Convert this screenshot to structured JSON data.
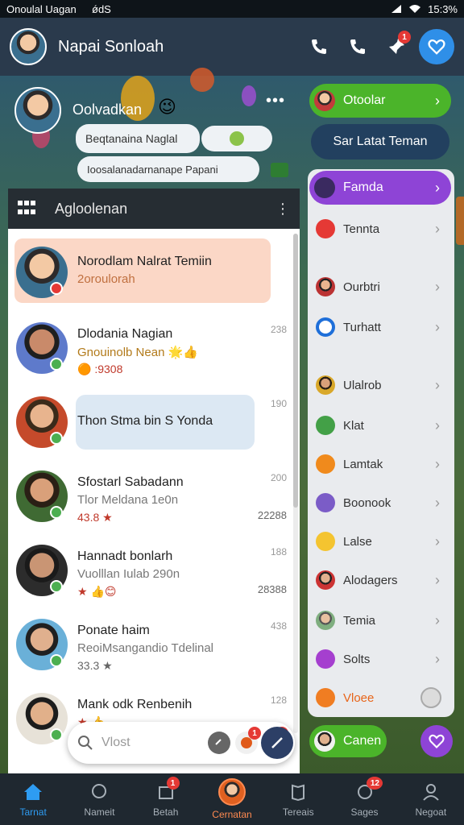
{
  "status_bar": {
    "left_text": "Onoulal Uagan",
    "carrier": "ǿdS",
    "time": "15:3%"
  },
  "header": {
    "title": "Napai Sonloah",
    "badge_count": "1"
  },
  "profile": {
    "name": "Oolvadkan",
    "emoji": "😉",
    "more": "•••",
    "bubble1": "Beqtanaina Naglal",
    "bubble2": "Ioosalanadarnanape Papani"
  },
  "left_panel": {
    "title": "Agloolenan"
  },
  "chats": [
    {
      "name": "Norodlam Nalrat Temiin",
      "sub": "2oroulorah",
      "extra": "",
      "time": "",
      "count": ""
    },
    {
      "name": "Dlodania Nagian",
      "sub": "Gnouinolb Nean 🌟👍",
      "extra": "🟠 :9308",
      "time": "238",
      "count": ""
    },
    {
      "name": "Thon Stma bin S Yonda",
      "sub": "",
      "extra": "",
      "time": "190",
      "count": ""
    },
    {
      "name": "Sfostarl Sabadann",
      "sub": "Tlor Meldana 1e0n",
      "extra": "43.8 ★",
      "time": "200",
      "count": "22288"
    },
    {
      "name": "Hannadt bonlarh",
      "sub": "Vuolllan Iulab 290n",
      "extra": "★ 👍😊",
      "time": "188",
      "count": "28388"
    },
    {
      "name": "Ponate haim",
      "sub": "ReoiMsangandio Tdelinal",
      "extra": "33.3 ★",
      "time": "438",
      "count": ""
    },
    {
      "name": "Mank odk Renbenih",
      "sub": "",
      "extra": "★ 👍",
      "time": "128",
      "count": ""
    }
  ],
  "search": {
    "placeholder": "Vlost",
    "badge_a": "1",
    "badge_b": "1"
  },
  "right": {
    "top_pill": "Otoolar",
    "blue_pill": "Sar Latat Teman",
    "purple_pill": "Famda",
    "items": [
      "Tennta",
      "Ourbtri",
      "Turhatt",
      "Ulalrob",
      "Klat",
      "Lamtak",
      "Boonook",
      "Lalse",
      "Alodagers",
      "Temia",
      "Solts",
      "Vloee"
    ],
    "bottom_pill": "Canen"
  },
  "nav": [
    {
      "label": "Tarnat",
      "badge": ""
    },
    {
      "label": "Nameit",
      "badge": ""
    },
    {
      "label": "Betah",
      "badge": "1"
    },
    {
      "label": "Cernatan",
      "badge": ""
    },
    {
      "label": "Tereais",
      "badge": ""
    },
    {
      "label": "Sages",
      "badge": "12"
    },
    {
      "label": "Negoat",
      "badge": ""
    }
  ],
  "colors": {
    "accent": "#2f8fe8",
    "green_pill": "#4bb42a",
    "purple_pill": "#8e44d6",
    "navy_pill": "#22405f",
    "highlight_card": "#fbd7c6",
    "active_nav": "#2e9cf2"
  },
  "icons": {
    "header": [
      "phone-icon",
      "phone-icon",
      "pin-icon",
      "heart-icon"
    ],
    "nav": [
      "home-icon",
      "chat-bubble-icon",
      "box-icon",
      "avatar",
      "book-icon",
      "badge-icon",
      "person-icon"
    ]
  }
}
